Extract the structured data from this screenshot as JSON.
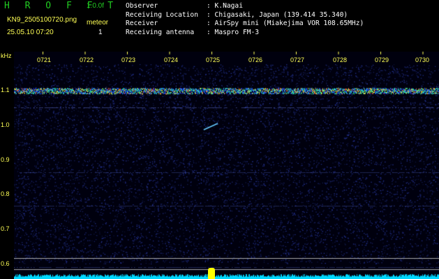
{
  "header": {
    "app_title": "H R O F F T",
    "version": "1.0.0f",
    "filename": "KN9_2505100720.png",
    "mode_label": "meteor",
    "mode_value": "1",
    "timestamp": "25.05.10 07:20"
  },
  "info": [
    {
      "key": "Observer",
      "value": ": K.Nagai"
    },
    {
      "key": "Receiving Location",
      "value": ": Chigasaki, Japan (139.414 35.340)"
    },
    {
      "key": "Receiver",
      "value": ": AirSpy mini (Miakejima VOR 108.65MHz)"
    },
    {
      "key": "Receiving antenna",
      "value": ": Maspro FM-3"
    }
  ],
  "spectrogram": {
    "y_unit": "kHz",
    "y_ticks": [
      "1.1",
      "1.0",
      "0.9",
      "0.8",
      "0.7",
      "0.6"
    ],
    "x_ticks": [
      "0721",
      "0722",
      "0723",
      "0724",
      "0725",
      "0726",
      "0727",
      "0728",
      "0729",
      "0730"
    ],
    "colors": {
      "label": "#ffff55",
      "background": "#000010",
      "signal": "#33ff99",
      "noise": "#00d8ff"
    }
  }
}
